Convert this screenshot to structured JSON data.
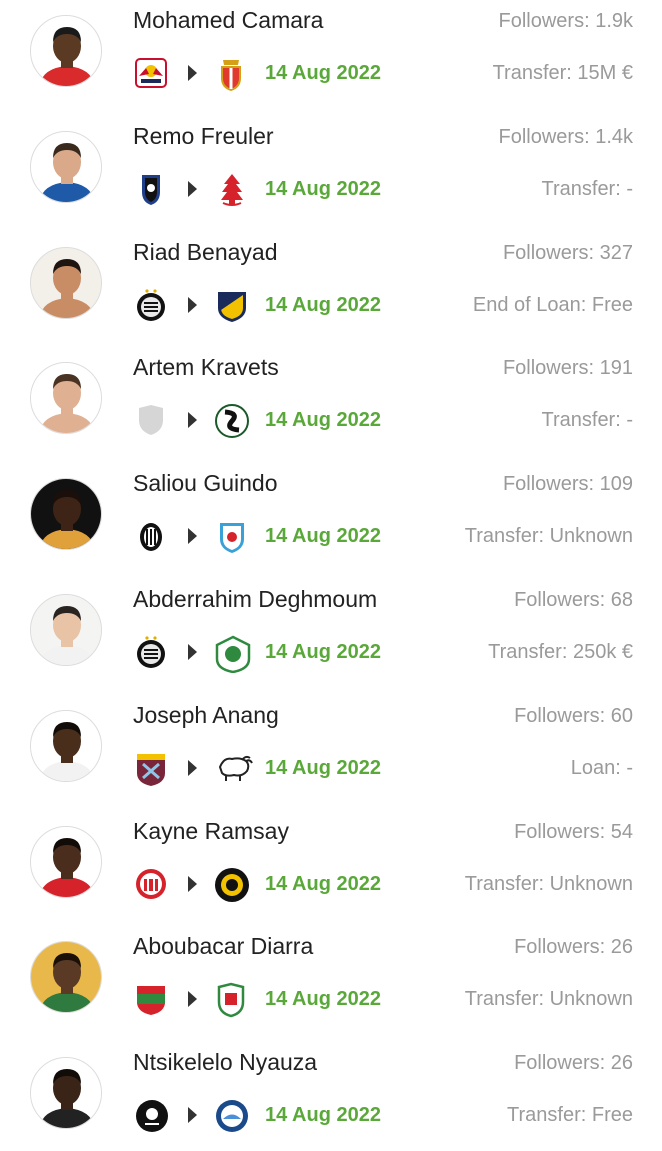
{
  "transfers": [
    {
      "name": "Mohamed Camara",
      "followers": "Followers: 1.9k",
      "date": "14 Aug 2022",
      "transfer": "Transfer: 15M €",
      "skin": "#5a3a22",
      "hair": "#1a1a1a",
      "shirt": "#d92b2b",
      "bg": "#ffffff",
      "from_icon": "rb-salzburg-crest-icon",
      "to_icon": "monaco-crest-icon"
    },
    {
      "name": "Remo Freuler",
      "followers": "Followers: 1.4k",
      "date": "14 Aug 2022",
      "transfer": "Transfer: -",
      "skin": "#d9a98a",
      "hair": "#3a2a1e",
      "shirt": "#1f5aa8",
      "bg": "#ffffff",
      "from_icon": "atalanta-crest-icon",
      "to_icon": "nottingham-forest-crest-icon"
    },
    {
      "name": "Riad Benayad",
      "followers": "Followers: 327",
      "date": "14 Aug 2022",
      "transfer": "End of Loan: Free",
      "skin": "#c98d66",
      "hair": "#1e1410",
      "shirt": "#c98d66",
      "bg": "#f3efe9",
      "from_icon": "charleroi-crest-icon",
      "to_icon": "paris-fc-crest-icon"
    },
    {
      "name": "Artem Kravets",
      "followers": "Followers: 191",
      "date": "14 Aug 2022",
      "transfer": "Transfer: -",
      "skin": "#e0b093",
      "hair": "#4a3322",
      "shirt": "#e0b093",
      "bg": "#ffffff",
      "from_icon": "default-shield-icon",
      "to_icon": "sakaryaspor-crest-icon"
    },
    {
      "name": "Saliou Guindo",
      "followers": "Followers: 109",
      "date": "14 Aug 2022",
      "transfer": "Transfer: Unknown",
      "skin": "#3d2416",
      "hair": "#1a0f0a",
      "shirt": "#e0a03a",
      "bg": "#111111",
      "from_icon": "sion-crest-icon",
      "to_icon": "tondela-crest-icon"
    },
    {
      "name": "Abderrahim Deghmoum",
      "followers": "Followers: 68",
      "date": "14 Aug 2022",
      "transfer": "Transfer: 250k €",
      "skin": "#e8c3a6",
      "hair": "#2a2420",
      "shirt": "#f2f2f2",
      "bg": "#f4f4f2",
      "from_icon": "charleroi-crest-icon",
      "to_icon": "al-masry-crest-icon"
    },
    {
      "name": "Joseph Anang",
      "followers": "Followers: 60",
      "date": "14 Aug 2022",
      "transfer": "Loan: -",
      "skin": "#4a2e1c",
      "hair": "#120c08",
      "shirt": "#f2f2f2",
      "bg": "#ffffff",
      "from_icon": "west-ham-crest-icon",
      "to_icon": "derby-county-crest-icon"
    },
    {
      "name": "Kayne Ramsay",
      "followers": "Followers: 54",
      "date": "14 Aug 2022",
      "transfer": "Transfer: Unknown",
      "skin": "#4a2d1c",
      "hair": "#120c08",
      "shirt": "#d6232b",
      "bg": "#ffffff",
      "from_icon": "southampton-crest-icon",
      "to_icon": "harrogate-crest-icon"
    },
    {
      "name": "Aboubacar Diarra",
      "followers": "Followers: 26",
      "date": "14 Aug 2022",
      "transfer": "Transfer: Unknown",
      "skin": "#5a3a24",
      "hair": "#1a1008",
      "shirt": "#2f7a3f",
      "bg": "#e8b84a",
      "from_icon": "djoliba-crest-icon",
      "to_icon": "al-wehdat-crest-icon"
    },
    {
      "name": "Ntsikelelo Nyauza",
      "followers": "Followers: 26",
      "date": "14 Aug 2022",
      "transfer": "Transfer: Free",
      "skin": "#3a2418",
      "hair": "#120c08",
      "shirt": "#222222",
      "bg": "#ffffff",
      "from_icon": "orlando-pirates-crest-icon",
      "to_icon": "richards-bay-crest-icon"
    }
  ]
}
